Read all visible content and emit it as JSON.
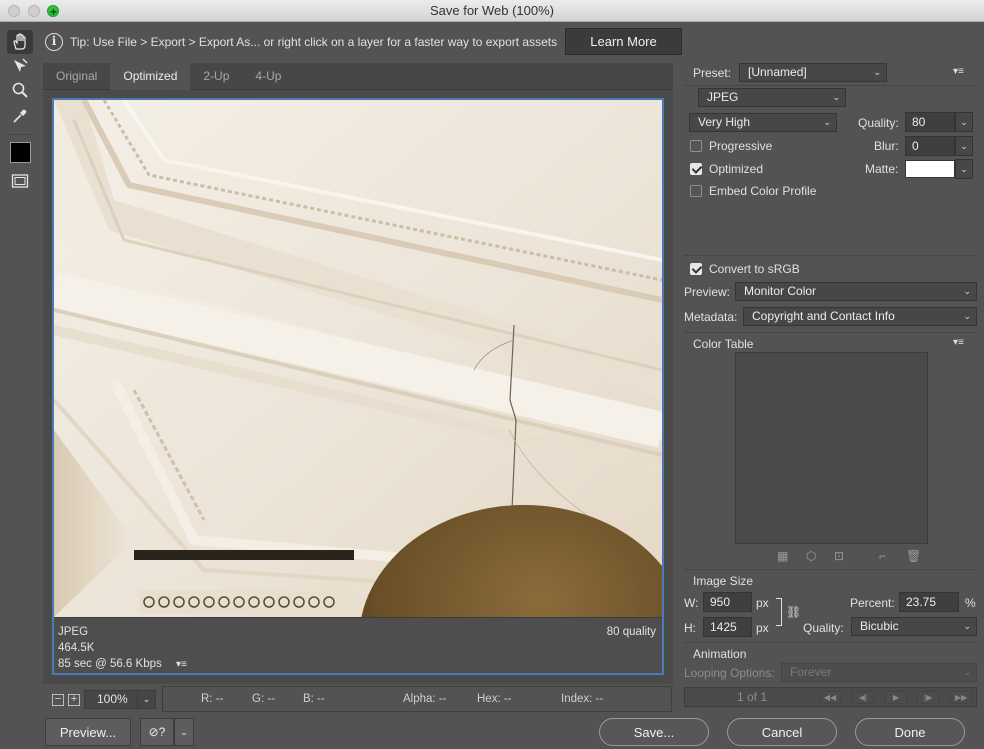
{
  "window": {
    "title": "Save for Web (100%)"
  },
  "tip": {
    "text": "Tip: Use File > Export > Export As...  or right click on a layer for a faster way to export assets",
    "learn_more": "Learn More"
  },
  "tabs": [
    {
      "label": "Original"
    },
    {
      "label": "Optimized"
    },
    {
      "label": "2-Up"
    },
    {
      "label": "4-Up"
    }
  ],
  "preview_info": {
    "format": "JPEG",
    "size": "464.5K",
    "time": "85 sec @ 56.6 Kbps",
    "quality": "80 quality"
  },
  "status": {
    "zoom": "100%",
    "r": "R: --",
    "g": "G: --",
    "b": "B: --",
    "alpha": "Alpha: --",
    "hex": "Hex: --",
    "index": "Index: --"
  },
  "buttons": {
    "preview": "Preview...",
    "save": "Save...",
    "cancel": "Cancel",
    "done": "Done"
  },
  "settings": {
    "preset_label": "Preset:",
    "preset_value": "[Unnamed]",
    "format": "JPEG",
    "compression": "Very High",
    "quality_label": "Quality:",
    "quality_value": "80",
    "blur_label": "Blur:",
    "blur_value": "0",
    "matte_label": "Matte:",
    "matte_color": "#ffffff",
    "progressive": "Progressive",
    "optimized": "Optimized",
    "embed_profile": "Embed Color Profile",
    "convert_srgb": "Convert to sRGB",
    "preview_label": "Preview:",
    "preview_value": "Monitor Color",
    "metadata_label": "Metadata:",
    "metadata_value": "Copyright and Contact Info",
    "color_table": "Color Table"
  },
  "image_size": {
    "title": "Image Size",
    "w_label": "W:",
    "w_value": "950",
    "h_label": "H:",
    "h_value": "1425",
    "unit": "px",
    "percent_label": "Percent:",
    "percent_value": "23.75",
    "percent_unit": "%",
    "quality_label": "Quality:",
    "quality_value": "Bicubic"
  },
  "animation": {
    "title": "Animation",
    "looping_label": "Looping Options:",
    "looping_value": "Forever",
    "frame": "1 of 1"
  },
  "colors": {
    "accent": "#4a7bb7",
    "panel": "#535353"
  }
}
